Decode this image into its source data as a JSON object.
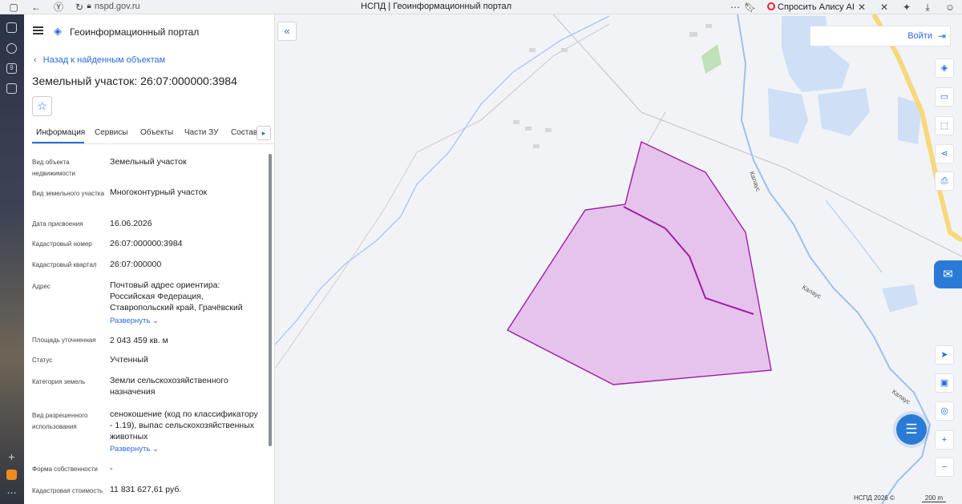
{
  "browser": {
    "url": "nspd.gov.ru",
    "tab_title": "НСПД | Геоинформационный портал",
    "alice_label": "Спросить Алису AI",
    "rail_badge": "9"
  },
  "panel": {
    "portal_name": "Геоинформационный портал",
    "back_link": "Назад к найденным объектам",
    "title": "Земельный участок: 26:07:000000:3984",
    "tabs": [
      "Информация",
      "Сервисы",
      "Объекты",
      "Части ЗУ",
      "Состав"
    ],
    "fields": [
      {
        "label": "Вид объекта недвижимости",
        "value": "Земельный участок"
      },
      {
        "label": "Вид земельного участка",
        "value": "Многоконтурный участок"
      },
      {
        "label": "Дата присвоения",
        "value": "16.06.2026"
      },
      {
        "label": "Кадастровый номер",
        "value": "26:07:000000:3984"
      },
      {
        "label": "Кадастровый квартал",
        "value": "26:07:000000"
      },
      {
        "label": "Адрес",
        "value": "Почтовый адрес ориентира: Российская Федерация, Ставропольский край, Грачёвский"
      },
      {
        "label": "Площадь уточненная",
        "value": "2 043 459 кв. м"
      },
      {
        "label": "Статус",
        "value": "Учтенный"
      },
      {
        "label": "Категория земель",
        "value": "Земли сельскохозяйственного назначения"
      },
      {
        "label": "Вид разрешенного использования",
        "value": "сенокошение (код по классификатору - 1.19), выпас сельскохозяйственных животных"
      },
      {
        "label": "Форма собственности",
        "value": "-"
      },
      {
        "label": "Кадастровая стоимость",
        "value": "11 831 627,61 руб."
      }
    ],
    "expand_label": "Развернуть"
  },
  "map": {
    "login_label": "Войти",
    "river_label": "Калаус",
    "attribution": "НСПД 2026 ©",
    "scale": "200 m",
    "parcel_color": "#e6c3ec",
    "parcel_stroke": "#9b1fa6"
  }
}
